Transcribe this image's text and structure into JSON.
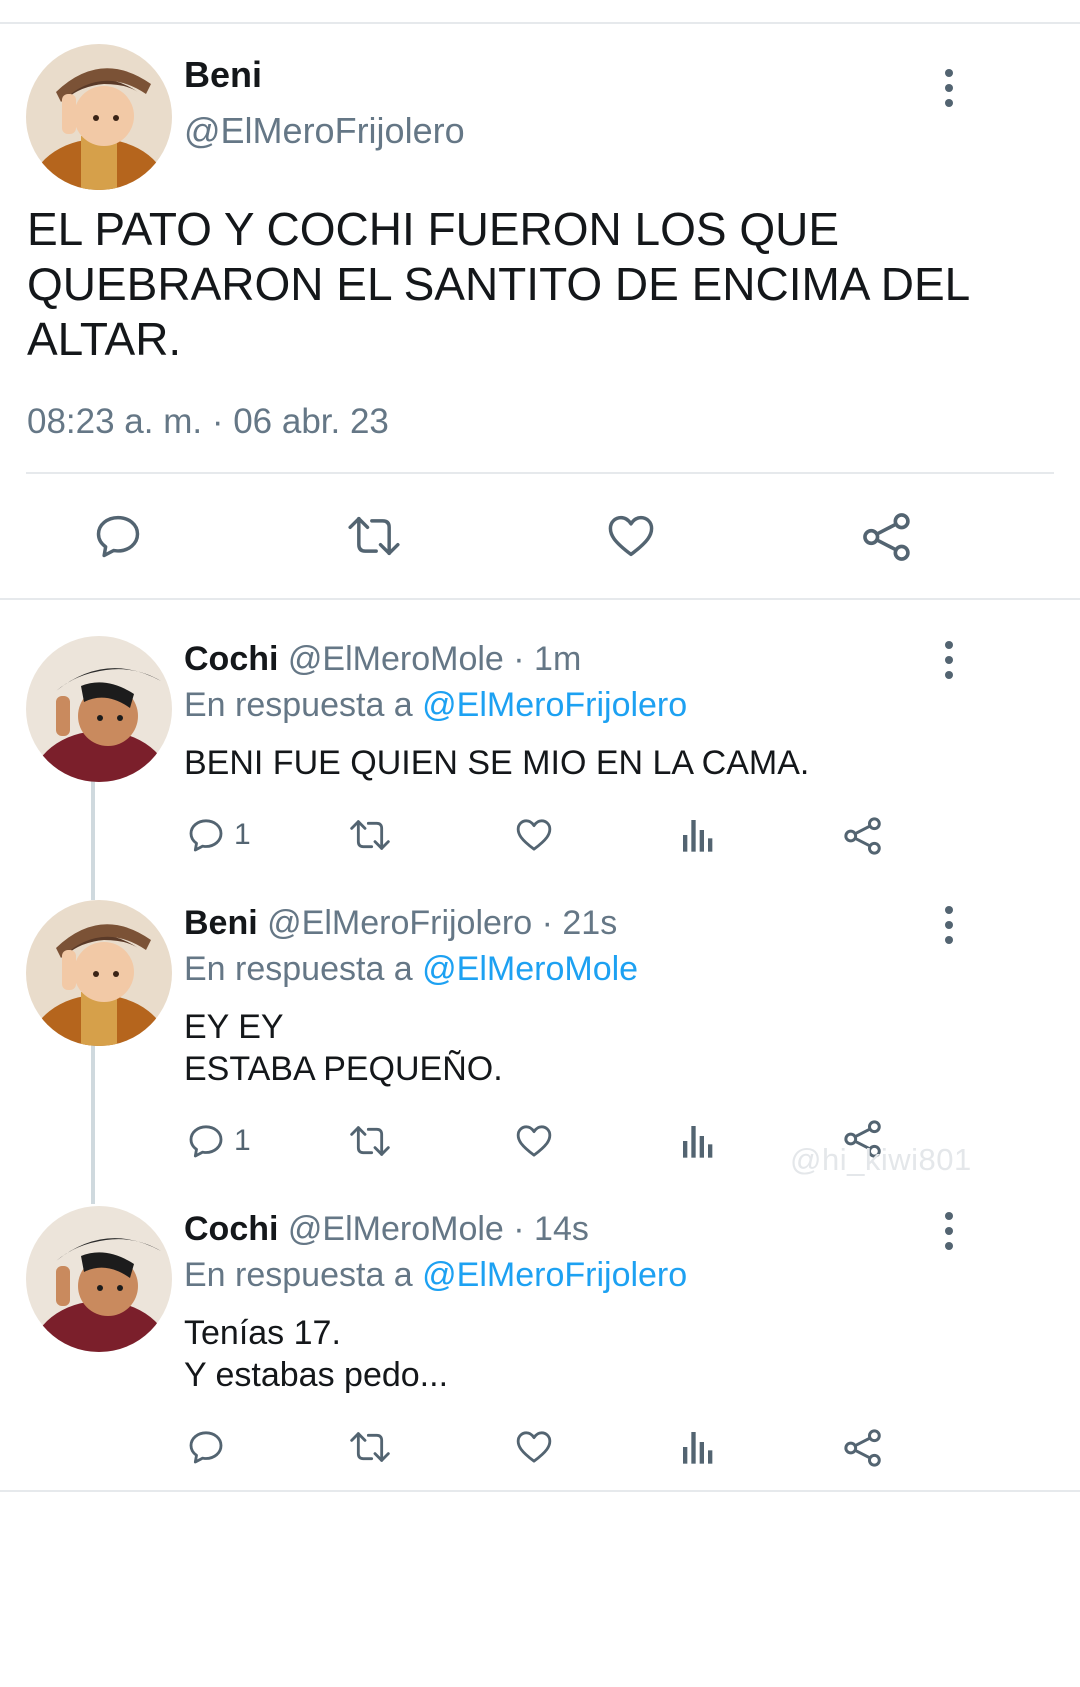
{
  "main_tweet": {
    "display_name": "Beni",
    "handle": "@ElMeroFrijolero",
    "text_lines": [
      "EL PATO Y COCHI FUERON LOS QUE",
      "QUEBRARON EL SANTITO DE ENCIMA DEL",
      "ALTAR."
    ],
    "timestamp": "08:23 a. m. · 06 abr. 23",
    "actions": [
      "reply-icon",
      "retweet-icon",
      "like-icon",
      "share-icon"
    ]
  },
  "replies": [
    {
      "display_name": "Cochi",
      "handle": "@ElMeroMole",
      "time": "· 1m",
      "reply_prefix": "En respuesta a",
      "reply_to": "@ElMeroFrijolero",
      "text_lines": [
        "BENI FUE QUIEN SE MIO EN LA CAMA."
      ],
      "reply_count": "1"
    },
    {
      "display_name": "Beni",
      "handle": "@ElMeroFrijolero",
      "time": "· 21s",
      "reply_prefix": "En respuesta a",
      "reply_to": "@ElMeroMole",
      "text_lines": [
        "EY EY",
        "ESTABA PEQUEÑO."
      ],
      "reply_count": "1"
    },
    {
      "display_name": "Cochi",
      "handle": "@ElMeroMole",
      "time": "· 14s",
      "reply_prefix": "En respuesta a",
      "reply_to": "@ElMeroFrijolero",
      "text_lines": [
        "Tenías 17.",
        "Y estabas pedo..."
      ],
      "reply_count": ""
    }
  ],
  "watermark": "@hi_kiwi801",
  "colors": {
    "link": "#1da1f2",
    "muted": "#657786",
    "icon": "#536471",
    "divider": "#e6e9ec"
  }
}
